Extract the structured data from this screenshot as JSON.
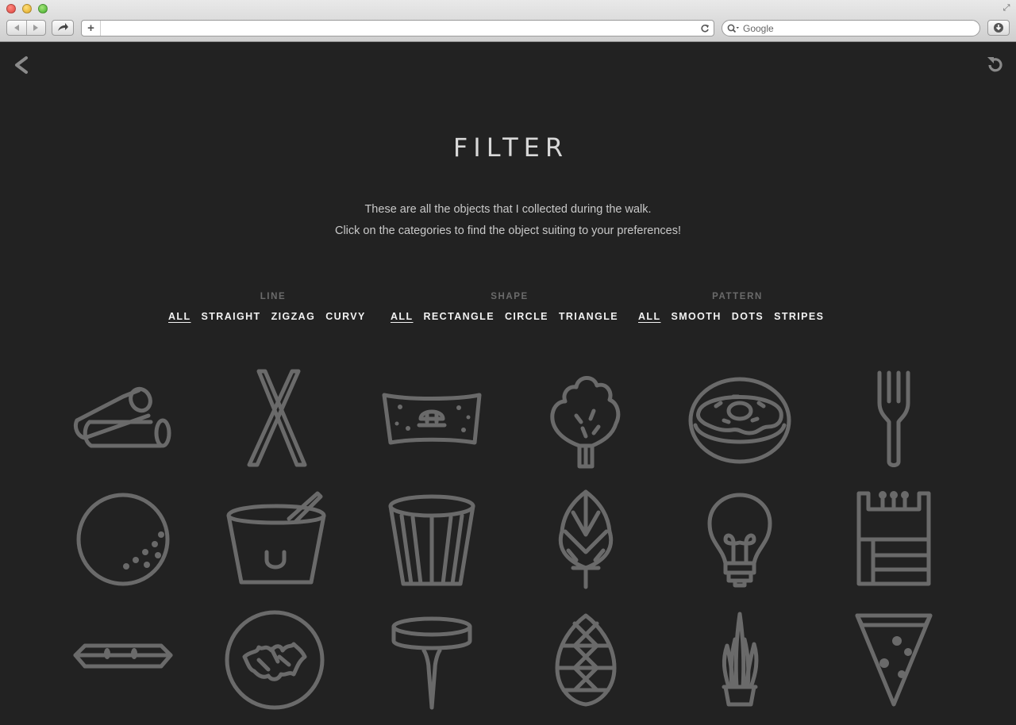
{
  "browser": {
    "url": "",
    "search_placeholder": "Google",
    "new_tab_label": "+"
  },
  "page": {
    "title": "FILTER",
    "intro_line1": "These are all the objects that I collected during the walk.",
    "intro_line2": "Click on the categories to find the object suiting to your preferences!"
  },
  "filters": {
    "line": {
      "label": "LINE",
      "options": [
        "ALL",
        "STRAIGHT",
        "ZIGZAG",
        "CURVY"
      ],
      "selected": "ALL"
    },
    "shape": {
      "label": "SHAPE",
      "options": [
        "ALL",
        "RECTANGLE",
        "CIRCLE",
        "TRIANGLE"
      ],
      "selected": "ALL"
    },
    "pattern": {
      "label": "PATTERN",
      "options": [
        "ALL",
        "SMOOTH",
        "DOTS",
        "STRIPES"
      ],
      "selected": "ALL"
    }
  },
  "objects": [
    "pipes",
    "chopsticks",
    "banknote",
    "broccoli",
    "donut",
    "fork",
    "ball",
    "cup",
    "bin",
    "hop",
    "lightbulb",
    "matchbox",
    "candy-bar",
    "leaf-badge",
    "pushpin",
    "pinecone",
    "plant",
    "pizza-slice"
  ],
  "colors": {
    "background": "#222222",
    "icon": "#6a6a6a",
    "text": "#f2f2f2",
    "muted": "#6b6b6b"
  }
}
